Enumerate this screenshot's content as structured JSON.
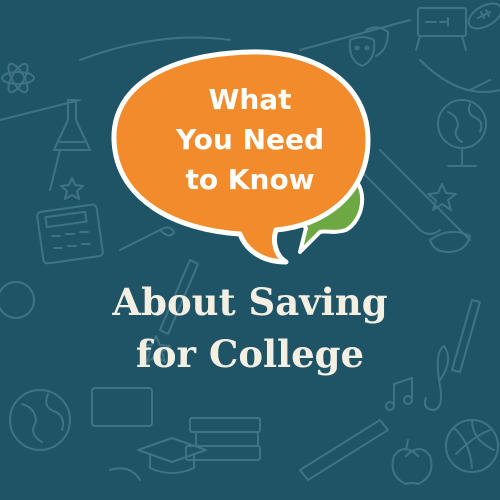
{
  "bubble": {
    "line1": "What",
    "line2": "You Need",
    "line3": "to Know"
  },
  "headline": {
    "line1": "About Saving",
    "line2": "for College"
  },
  "colors": {
    "background": "#1f5466",
    "orange_bubble": "#f28b2c",
    "green_bubble": "#6ea842",
    "bubble_outline": "#ffffff",
    "headline_text": "#f3efe3",
    "doodle_lines": "#3f7384"
  },
  "icons": [
    "atom-icon",
    "comedy-tragedy-masks-icon",
    "emc2-icon",
    "globe-icon",
    "test-tube-icon",
    "star-icon",
    "calculator-icon",
    "paintbrush-icon",
    "pencil-icon",
    "apple-icon",
    "graduation-cap-icon",
    "book-stack-icon",
    "music-note-icon",
    "treble-clef-icon",
    "volleyball-icon",
    "football-icon",
    "ruler-icon",
    "paint-tube-icon"
  ]
}
